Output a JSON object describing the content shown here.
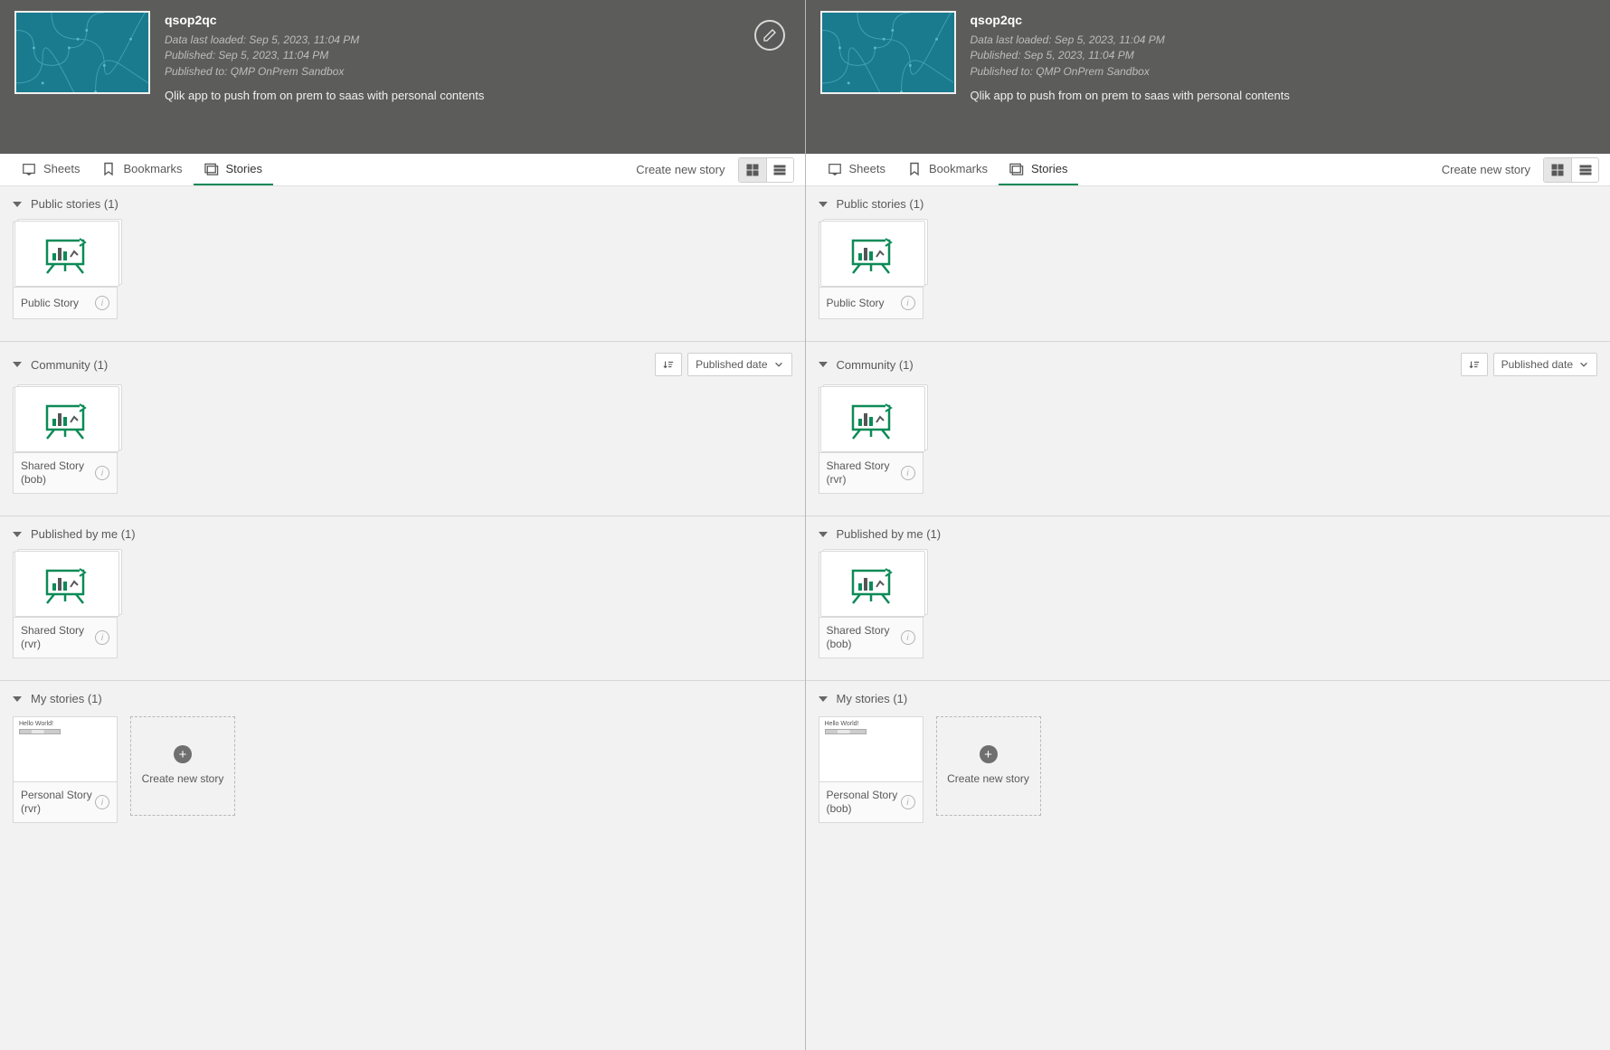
{
  "left": {
    "header": {
      "title": "qsop2qc",
      "meta1": "Data last loaded: Sep 5, 2023, 11:04 PM",
      "meta2": "Published: Sep 5, 2023, 11:04 PM",
      "meta3": "Published to: QMP OnPrem Sandbox",
      "description": "Qlik app to push from on prem to saas with personal contents"
    },
    "tabs": {
      "sheets": "Sheets",
      "bookmarks": "Bookmarks",
      "stories": "Stories",
      "create": "Create new story"
    },
    "sections": {
      "public": {
        "title": "Public stories (1)",
        "card": "Public Story"
      },
      "community": {
        "title": "Community (1)",
        "sort": "Published date",
        "card": "Shared Story (bob)"
      },
      "published": {
        "title": "Published by me (1)",
        "card": "Shared Story (rvr)"
      },
      "my": {
        "title": "My stories (1)",
        "card": "Personal Story (rvr)",
        "hello": "Hello World!",
        "create": "Create new story"
      }
    }
  },
  "right": {
    "header": {
      "title": "qsop2qc",
      "meta1": "Data last loaded: Sep 5, 2023, 11:04 PM",
      "meta2": "Published: Sep 5, 2023, 11:04 PM",
      "meta3": "Published to: QMP OnPrem Sandbox",
      "description": "Qlik app to push from on prem to saas with personal contents"
    },
    "tabs": {
      "sheets": "Sheets",
      "bookmarks": "Bookmarks",
      "stories": "Stories",
      "create": "Create new story"
    },
    "sections": {
      "public": {
        "title": "Public stories (1)",
        "card": "Public Story"
      },
      "community": {
        "title": "Community (1)",
        "sort": "Published date",
        "card": "Shared Story (rvr)"
      },
      "published": {
        "title": "Published by me (1)",
        "card": "Shared Story (bob)"
      },
      "my": {
        "title": "My stories (1)",
        "card": "Personal Story (bob)",
        "hello": "Hello World!",
        "create": "Create new story"
      }
    }
  }
}
